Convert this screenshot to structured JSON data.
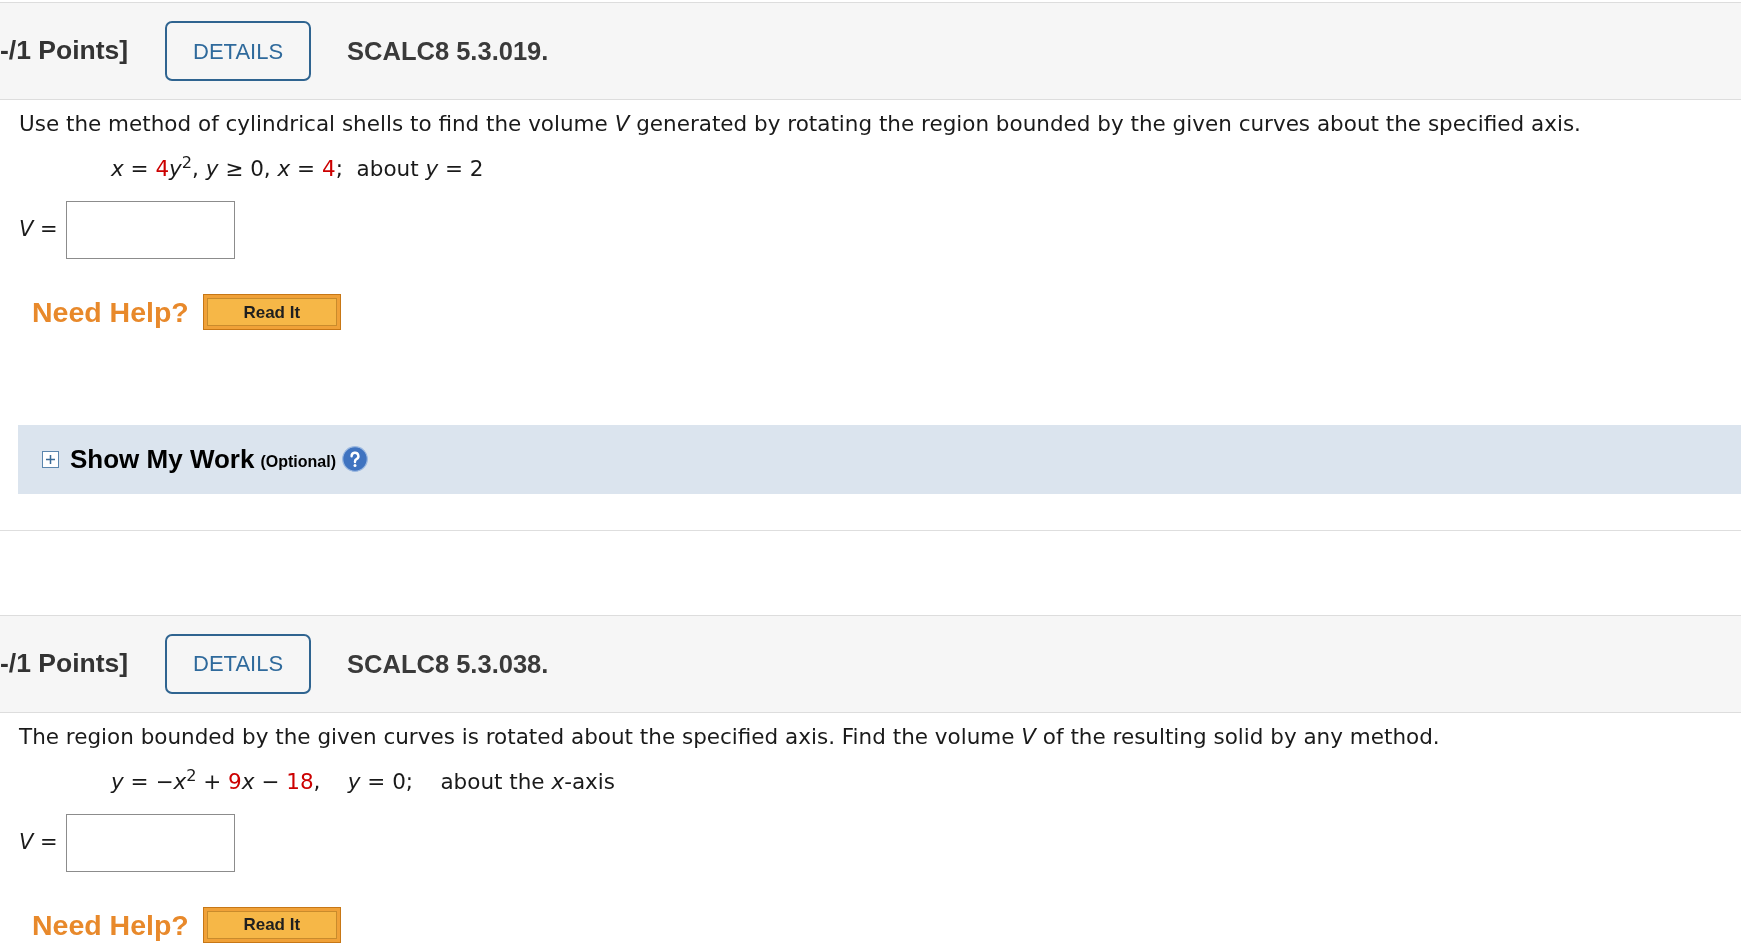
{
  "problems": [
    {
      "points": "-/1 Points]",
      "details_button": "DETAILS",
      "code": "SCALC8 5.3.019.",
      "question": "Use the method of cylindrical shells to find the volume *V* generated by rotating the region bounded by the given curves about the specified axis.",
      "equation": [
        {
          "text": "*x* = ",
          "highlight": false
        },
        {
          "text": "4",
          "highlight": true
        },
        {
          "text": "*y*$^{2}$, *y* ≥ 0, *x* = ",
          "highlight": false
        },
        {
          "text": "4",
          "highlight": true
        },
        {
          "text": ";  about *y* = 2",
          "highlight": false
        }
      ],
      "answer": {
        "label": "*V* ="
      },
      "help": {
        "label": "Need Help?",
        "buttons": [
          "Read It"
        ]
      },
      "show_my_work": {
        "expanded": false,
        "title": "Show My Work",
        "note": "(Optional)"
      }
    },
    {
      "points": "-/1 Points]",
      "details_button": "DETAILS",
      "code": "SCALC8 5.3.038.",
      "question": "The region bounded by the given curves is rotated about the specified axis. Find the volume *V* of the resulting solid by any method.",
      "equation": [
        {
          "text": "*y* = −*x*$^{2}$ + ",
          "highlight": false
        },
        {
          "text": "9",
          "highlight": true
        },
        {
          "text": "*x* − ",
          "highlight": false
        },
        {
          "text": "18",
          "highlight": true
        },
        {
          "text": ",    *y* = 0;    about the *x*-axis",
          "highlight": false
        }
      ],
      "answer": {
        "label": "*V* ="
      },
      "help": {
        "label": "Need Help?",
        "buttons": [
          "Read It"
        ]
      }
    }
  ]
}
